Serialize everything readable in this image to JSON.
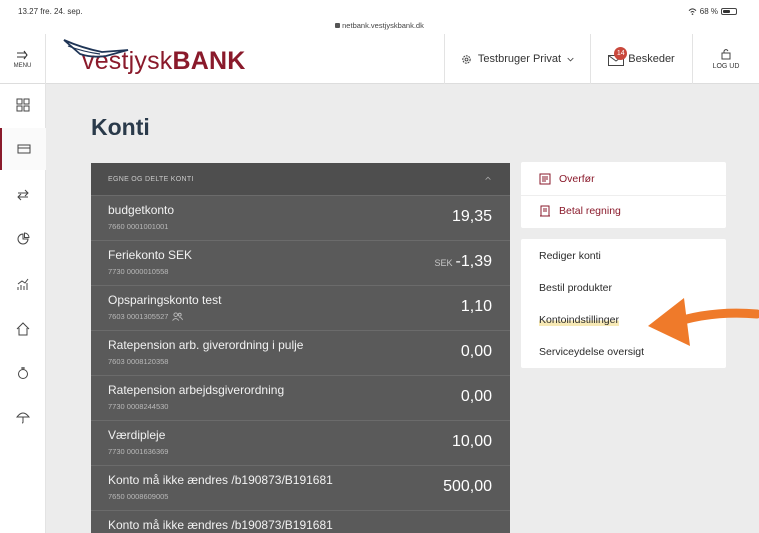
{
  "status": {
    "time": "13.27  fre. 24. sep.",
    "url": "netbank.vestjyskbank.dk",
    "battery": "68 %"
  },
  "header": {
    "menu_label": "MENU",
    "logo_part1": "vestjysk",
    "logo_part2": "BANK",
    "user_label": "Testbruger Privat",
    "messages_label": "Beskeder",
    "messages_count": "14",
    "logout_label": "LOG UD"
  },
  "page": {
    "title": "Konti"
  },
  "accounts": {
    "section_label": "EGNE OG DELTE KONTI",
    "rows": [
      {
        "name": "budgetkonto",
        "number": "7660 0001001001",
        "currency": "",
        "amount": "19,35"
      },
      {
        "name": "Feriekonto SEK",
        "number": "7730 0000010558",
        "currency": "SEK",
        "amount": "-1,39"
      },
      {
        "name": "Opsparingskonto test",
        "number": "7603 0001305527",
        "currency": "",
        "amount": "1,10"
      },
      {
        "name": "Ratepension arb. giverordning i pulje",
        "number": "7603 0008120358",
        "currency": "",
        "amount": "0,00"
      },
      {
        "name": "Ratepension arbejdsgiverordning",
        "number": "7730 0008244530",
        "currency": "",
        "amount": "0,00"
      },
      {
        "name": "Værdipleje",
        "number": "7730 0001636369",
        "currency": "",
        "amount": "10,00"
      },
      {
        "name": "Konto må ikke ændres /b190873/B191681",
        "number": "7650 0008609005",
        "currency": "",
        "amount": "500,00"
      },
      {
        "name": "Konto må ikke ændres /b190873/B191681",
        "number": "",
        "currency": "",
        "amount": ""
      }
    ]
  },
  "actions": {
    "primary": [
      {
        "label": "Overfør",
        "icon": "transfer-icon"
      },
      {
        "label": "Betal regning",
        "icon": "bill-icon"
      }
    ],
    "secondary": [
      {
        "label": "Rediger konti"
      },
      {
        "label": "Bestil produkter"
      },
      {
        "label": "Kontoindstillinger"
      },
      {
        "label": "Serviceydelse oversigt"
      }
    ]
  },
  "colors": {
    "brand": "#8a1a2b",
    "panel": "#5a5a5a",
    "annotation": "#ef7a2a"
  }
}
